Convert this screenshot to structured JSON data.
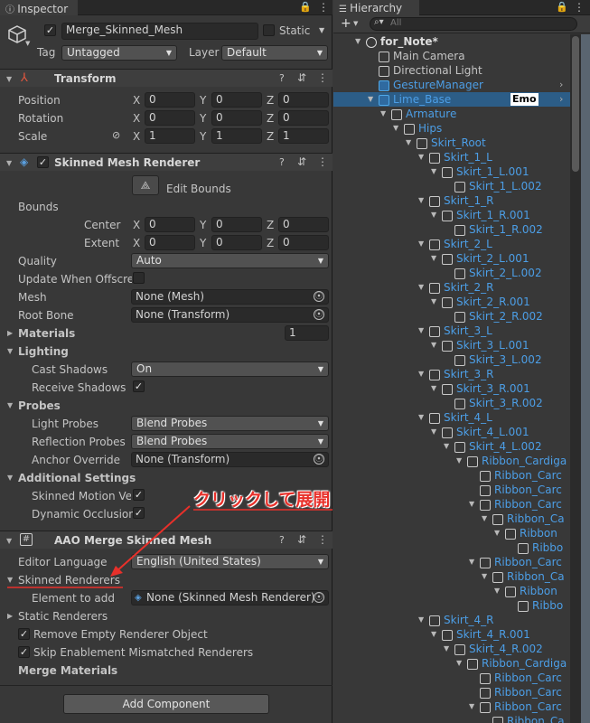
{
  "inspector": {
    "tab": "Inspector",
    "object_name": "Merge_Skinned_Mesh",
    "static_label": "Static",
    "tag_label": "Tag",
    "tag_value": "Untagged",
    "layer_label": "Layer",
    "layer_value": "Default",
    "transform": {
      "title": "Transform",
      "rows": [
        {
          "label": "Position",
          "x": "0",
          "y": "0",
          "z": "0"
        },
        {
          "label": "Rotation",
          "x": "0",
          "y": "0",
          "z": "0"
        },
        {
          "label": "Scale",
          "x": "1",
          "y": "1",
          "z": "1"
        }
      ]
    },
    "smr": {
      "title": "Skinned Mesh Renderer",
      "edit_bounds": "Edit Bounds",
      "bounds": "Bounds",
      "center": {
        "label": "Center",
        "x": "0",
        "y": "0",
        "z": "0"
      },
      "extent": {
        "label": "Extent",
        "x": "0",
        "y": "0",
        "z": "0"
      },
      "quality_label": "Quality",
      "quality_value": "Auto",
      "update_label": "Update When Offscree",
      "mesh_label": "Mesh",
      "mesh_value": "None (Mesh)",
      "rootbone_label": "Root Bone",
      "rootbone_value": "None (Transform)",
      "materials_label": "Materials",
      "materials_count": "1",
      "lighting": "Lighting",
      "cast_label": "Cast Shadows",
      "cast_value": "On",
      "receive_label": "Receive Shadows",
      "probes": "Probes",
      "light_probes_label": "Light Probes",
      "light_probes_value": "Blend Probes",
      "refl_label": "Reflection Probes",
      "refl_value": "Blend Probes",
      "anchor_label": "Anchor Override",
      "anchor_value": "None (Transform)",
      "additional": "Additional Settings",
      "motion_label": "Skinned Motion Vec",
      "dyn_label": "Dynamic Occlusion"
    },
    "aao": {
      "title": "AAO Merge Skinned Mesh",
      "lang_label": "Editor Language",
      "lang_value": "English (United States)",
      "skinned_renderers": "Skinned Renderers",
      "element_label": "Element to add",
      "element_value": "None (Skinned Mesh Renderer)",
      "static_renderers": "Static Renderers",
      "remove_empty": "Remove Empty Renderer Object",
      "skip_enable": "Skip Enablement Mismatched Renderers",
      "merge_materials": "Merge Materials"
    },
    "add_component": "Add Component",
    "annotation": "クリックして展開"
  },
  "hierarchy": {
    "tab": "Hierarchy",
    "search_placeholder": "All",
    "items": [
      {
        "label": "for_Note*",
        "depth": 0,
        "bold": true,
        "arrow": "down"
      },
      {
        "label": "Main Camera",
        "depth": 1,
        "arrow": ""
      },
      {
        "label": "Directional Light",
        "depth": 1,
        "arrow": ""
      },
      {
        "label": "GestureManager",
        "depth": 1,
        "arrow": "",
        "blue": true,
        "right": true
      },
      {
        "label": "Lime_Base",
        "depth": 1,
        "arrow": "down",
        "blue": true,
        "badge": "Emo",
        "right": true,
        "selected": true
      },
      {
        "label": "Armature",
        "depth": 2,
        "arrow": "down"
      },
      {
        "label": "Hips",
        "depth": 3,
        "arrow": "down"
      },
      {
        "label": "Skirt_Root",
        "depth": 4,
        "arrow": "down"
      },
      {
        "label": "Skirt_1_L",
        "depth": 5,
        "arrow": "down"
      },
      {
        "label": "Skirt_1_L.001",
        "depth": 6,
        "arrow": "down"
      },
      {
        "label": "Skirt_1_L.002",
        "depth": 7,
        "arrow": ""
      },
      {
        "label": "Skirt_1_R",
        "depth": 5,
        "arrow": "down"
      },
      {
        "label": "Skirt_1_R.001",
        "depth": 6,
        "arrow": "down"
      },
      {
        "label": "Skirt_1_R.002",
        "depth": 7,
        "arrow": ""
      },
      {
        "label": "Skirt_2_L",
        "depth": 5,
        "arrow": "down"
      },
      {
        "label": "Skirt_2_L.001",
        "depth": 6,
        "arrow": "down"
      },
      {
        "label": "Skirt_2_L.002",
        "depth": 7,
        "arrow": ""
      },
      {
        "label": "Skirt_2_R",
        "depth": 5,
        "arrow": "down"
      },
      {
        "label": "Skirt_2_R.001",
        "depth": 6,
        "arrow": "down"
      },
      {
        "label": "Skirt_2_R.002",
        "depth": 7,
        "arrow": ""
      },
      {
        "label": "Skirt_3_L",
        "depth": 5,
        "arrow": "down"
      },
      {
        "label": "Skirt_3_L.001",
        "depth": 6,
        "arrow": "down"
      },
      {
        "label": "Skirt_3_L.002",
        "depth": 7,
        "arrow": ""
      },
      {
        "label": "Skirt_3_R",
        "depth": 5,
        "arrow": "down"
      },
      {
        "label": "Skirt_3_R.001",
        "depth": 6,
        "arrow": "down"
      },
      {
        "label": "Skirt_3_R.002",
        "depth": 7,
        "arrow": ""
      },
      {
        "label": "Skirt_4_L",
        "depth": 5,
        "arrow": "down"
      },
      {
        "label": "Skirt_4_L.001",
        "depth": 6,
        "arrow": "down"
      },
      {
        "label": "Skirt_4_L.002",
        "depth": 7,
        "arrow": "down"
      },
      {
        "label": "Ribbon_Cardiga",
        "depth": 8,
        "arrow": "down"
      },
      {
        "label": "Ribbon_Carc",
        "depth": 9,
        "arrow": ""
      },
      {
        "label": "Ribbon_Carc",
        "depth": 9,
        "arrow": ""
      },
      {
        "label": "Ribbon_Carc",
        "depth": 9,
        "arrow": "down"
      },
      {
        "label": "Ribbon_Ca",
        "depth": 10,
        "arrow": "down"
      },
      {
        "label": "Ribbon",
        "depth": 11,
        "arrow": "down"
      },
      {
        "label": "Ribbo",
        "depth": 12,
        "arrow": ""
      },
      {
        "label": "Ribbon_Carc",
        "depth": 9,
        "arrow": "down"
      },
      {
        "label": "Ribbon_Ca",
        "depth": 10,
        "arrow": "down"
      },
      {
        "label": "Ribbon",
        "depth": 11,
        "arrow": "down"
      },
      {
        "label": "Ribbo",
        "depth": 12,
        "arrow": ""
      },
      {
        "label": "Skirt_4_R",
        "depth": 5,
        "arrow": "down"
      },
      {
        "label": "Skirt_4_R.001",
        "depth": 6,
        "arrow": "down"
      },
      {
        "label": "Skirt_4_R.002",
        "depth": 7,
        "arrow": "down"
      },
      {
        "label": "Ribbon_Cardiga",
        "depth": 8,
        "arrow": "down"
      },
      {
        "label": "Ribbon_Carc",
        "depth": 9,
        "arrow": ""
      },
      {
        "label": "Ribbon_Carc",
        "depth": 9,
        "arrow": ""
      },
      {
        "label": "Ribbon_Carc",
        "depth": 9,
        "arrow": "down"
      },
      {
        "label": "Ribbon_Ca",
        "depth": 10,
        "arrow": ""
      }
    ]
  },
  "colors": {
    "accent_red": "#e8302a",
    "blue_text": "#4c9ee6",
    "selection": "#2c5d87"
  },
  "icons": [
    "inspector-icon",
    "lock-icon",
    "menu-icon",
    "gameobject-cube-icon",
    "transform-icon",
    "skinned-mesh-icon",
    "help-icon",
    "settings-icon",
    "more-icon",
    "script-icon",
    "object-picker-icon",
    "hierarchy-icon",
    "plus-icon",
    "search-icon"
  ]
}
